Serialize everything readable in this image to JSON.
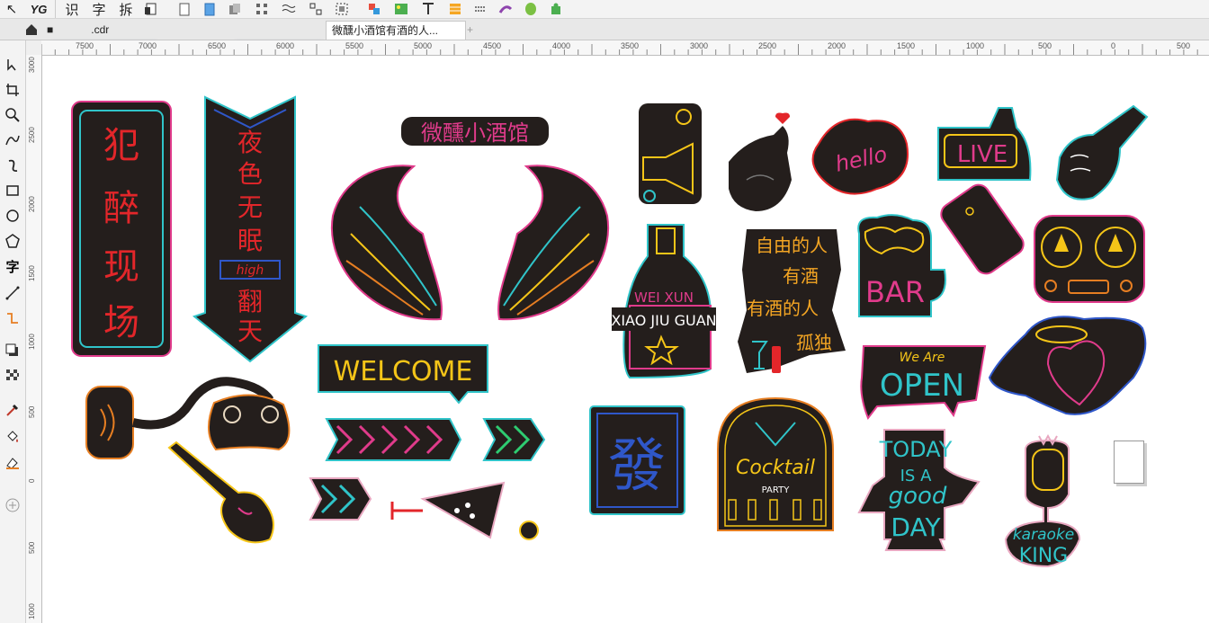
{
  "toolbar": {
    "items": [
      {
        "name": "pick-tool",
        "label": "↖"
      },
      {
        "name": "yg",
        "label": "YG"
      },
      {
        "name": "recognize",
        "label": "识"
      },
      {
        "name": "text",
        "label": "字"
      },
      {
        "name": "split",
        "label": "拆"
      }
    ]
  },
  "tabs": {
    "home_icon": "home-icon",
    "file1": "■       .cdr",
    "file2": "微醺小酒馆有酒的人...",
    "add": "+"
  },
  "ruler_top": {
    "labels": [
      "7500",
      "7000",
      "6500",
      "6000",
      "5500",
      "5000",
      "4500",
      "4000",
      "3500",
      "3000",
      "2500",
      "2000",
      "1500",
      "1000",
      "500",
      "0",
      "500"
    ]
  },
  "ruler_left": {
    "labels": [
      "3000",
      "2500",
      "2000",
      "1500",
      "1000",
      "500",
      "0",
      "500",
      "1000"
    ]
  },
  "stickers": {
    "vertical_sign_1": [
      "犯",
      "醉",
      "现",
      "场"
    ],
    "vertical_sign_2": [
      "夜",
      "色",
      "无",
      "眠"
    ],
    "vertical_sign_2_high": "high",
    "vertical_sign_2_bottom": [
      "翻",
      "天"
    ],
    "title": "微醺小酒馆",
    "welcome": "WELCOME",
    "live": "LIVE",
    "hello": "hello",
    "bottle_line1": "WEI XUN",
    "bottle_line2": "XIAO JIU GUAN",
    "poem": [
      "自由的人",
      "有酒",
      "有酒的人",
      "孤独"
    ],
    "bar": "BAR",
    "open_small": "We Are",
    "open": "OPEN",
    "fa": "發",
    "cocktail": "Cocktail",
    "party": "PARTY",
    "today": [
      "TODAY",
      "IS A",
      "good",
      "DAY"
    ],
    "karaoke": "karaoke",
    "king": "KING"
  }
}
